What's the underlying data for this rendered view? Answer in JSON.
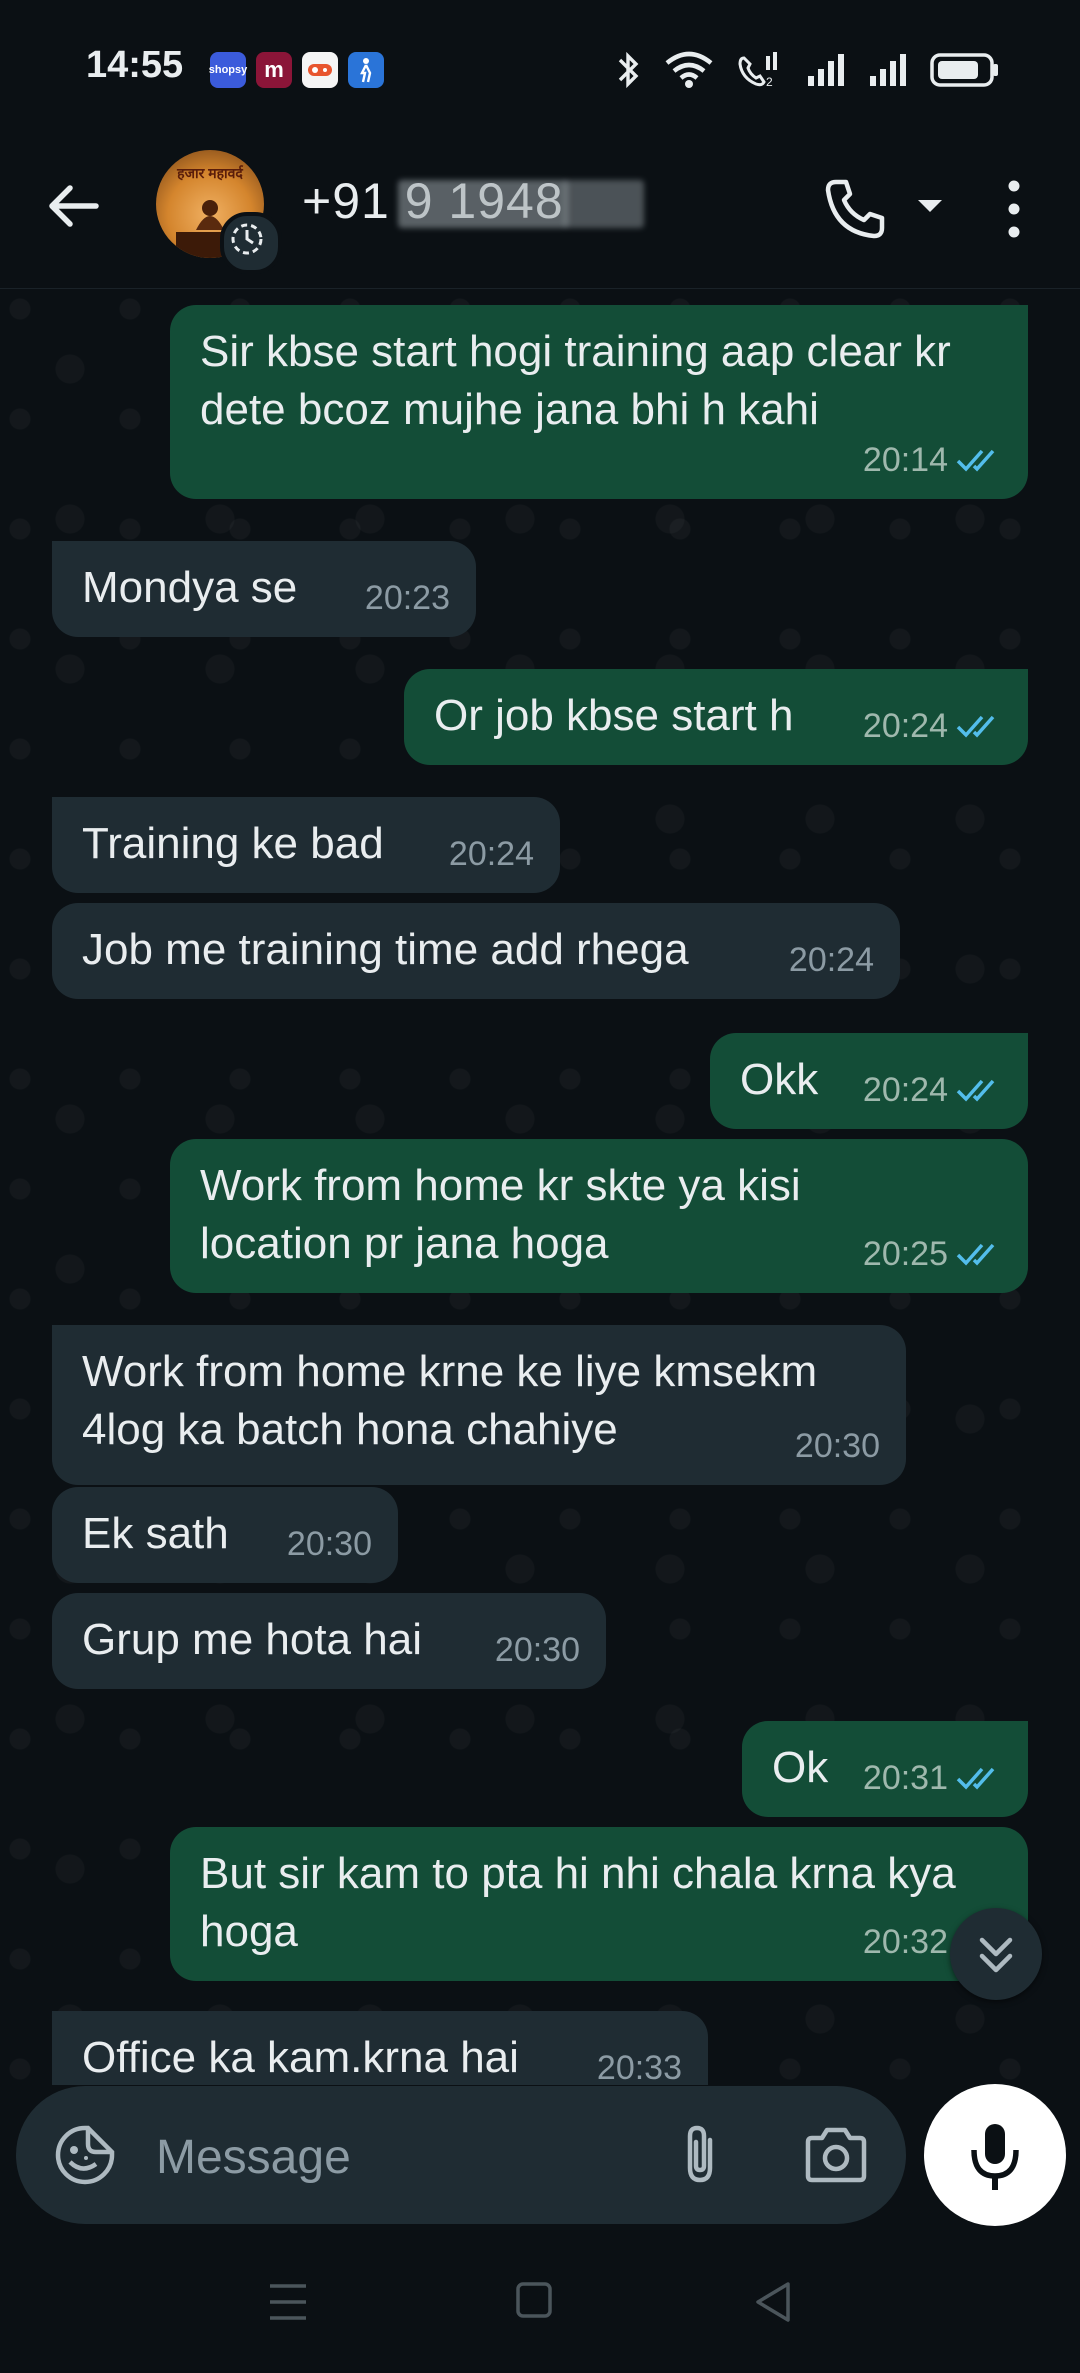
{
  "status_bar": {
    "time": "14:55",
    "apps": [
      {
        "label": "shopsy",
        "color": "#3b5bdb"
      },
      {
        "label": "m",
        "color": "#8b1538"
      },
      {
        "label": "",
        "color": "#f5f5f5"
      },
      {
        "label": "",
        "color": "#2a74d8"
      }
    ],
    "icons": [
      "bluetooth-icon",
      "wifi-icon",
      "volte-call-icon",
      "signal-icon",
      "signal-icon",
      "battery-icon"
    ]
  },
  "header": {
    "contact_name": "+91 9             1948",
    "avatar_text": "हजार महावर्द",
    "icons": [
      "back-arrow-icon",
      "phone-icon",
      "dropdown-icon",
      "more-vert-icon"
    ]
  },
  "messages": [
    {
      "dir": "out",
      "tail": true,
      "text": "Sir kbse start hogi training aap clear kr dete bcoz mujhe jana bhi h kahi",
      "time": "20:14",
      "read": true
    },
    {
      "dir": "in",
      "tail": true,
      "text": "Mondya se",
      "time": "20:23"
    },
    {
      "dir": "out",
      "tail": true,
      "text": "Or job kbse start h",
      "time": "20:24",
      "read": true
    },
    {
      "dir": "in",
      "tail": true,
      "text": "Training ke bad",
      "time": "20:24"
    },
    {
      "dir": "in",
      "tail": false,
      "text": "Job me training time add rhega",
      "time": "20:24"
    },
    {
      "dir": "out",
      "tail": true,
      "text": "Okk",
      "time": "20:24",
      "read": true
    },
    {
      "dir": "out",
      "tail": false,
      "text": "Work from home kr skte ya kisi location pr jana hoga",
      "time": "20:25",
      "read": true
    },
    {
      "dir": "in",
      "tail": true,
      "text": "Work from home krne ke liye kmsekm 4log ka batch hona chahiye",
      "time": "20:30"
    },
    {
      "dir": "in",
      "tail": false,
      "text": "Ek sath",
      "time": "20:30"
    },
    {
      "dir": "in",
      "tail": false,
      "text": "Grup me hota hai",
      "time": "20:30"
    },
    {
      "dir": "out",
      "tail": true,
      "text": "Ok",
      "time": "20:31",
      "read": true
    },
    {
      "dir": "out",
      "tail": false,
      "text": "But sir kam to pta hi nhi chala krna kya hoga",
      "time": "20:32",
      "read": true
    },
    {
      "dir": "in",
      "tail": true,
      "text": "Office ka kam.krna hai",
      "time": "20:33"
    }
  ],
  "composer": {
    "placeholder": "Message",
    "icons": [
      "emoji-icon",
      "attach-icon",
      "camera-icon",
      "mic-icon"
    ]
  },
  "colors": {
    "background": "#0b1014",
    "incoming_bubble": "#1f2c33",
    "outgoing_bubble": "#134d37",
    "read_tick": "#53bdeb"
  }
}
